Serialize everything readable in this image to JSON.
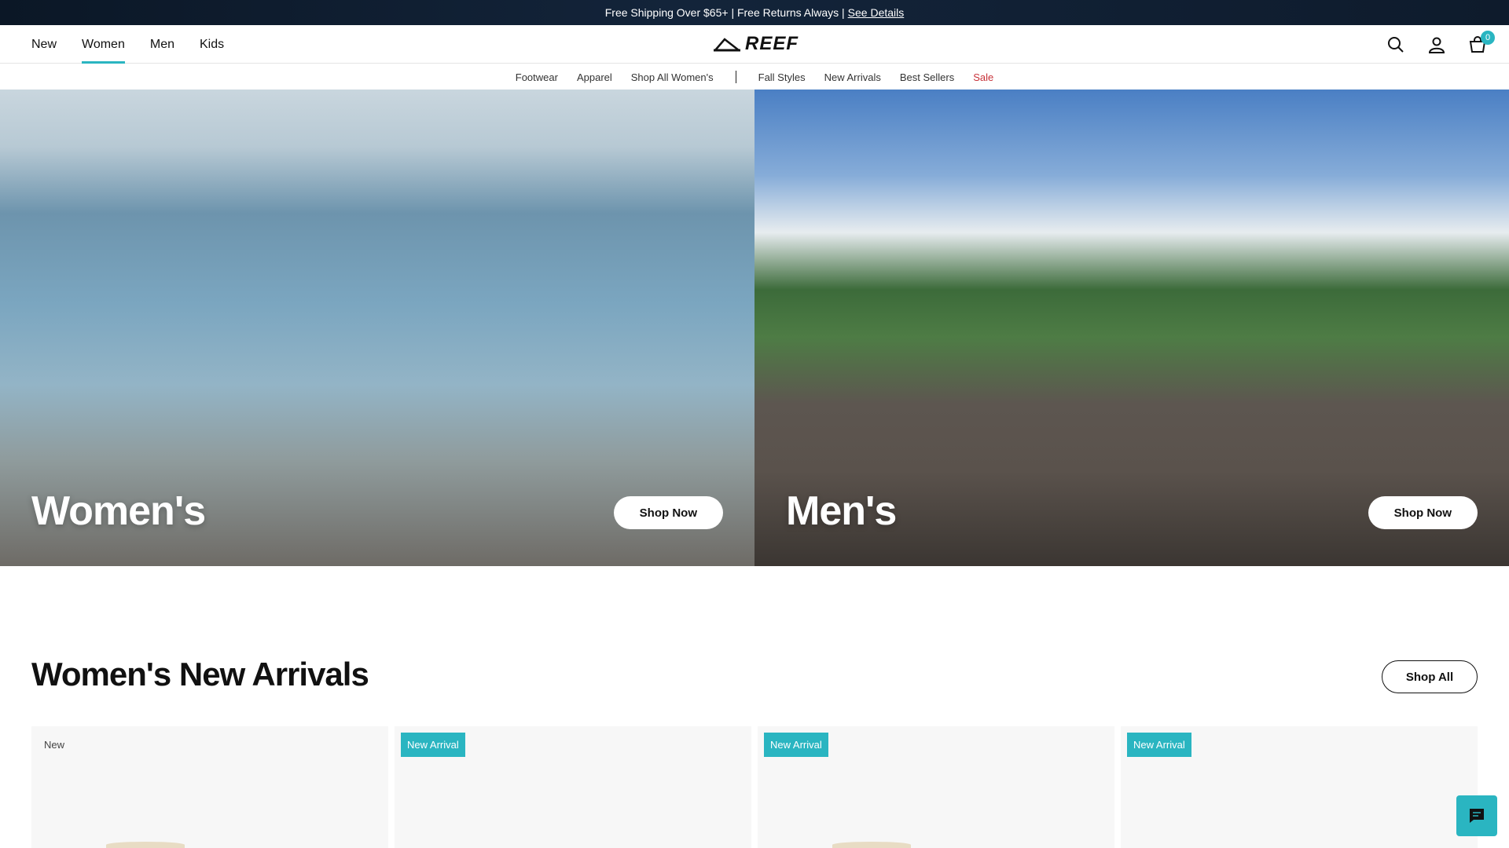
{
  "announcement": {
    "text": "Free Shipping Over $65+ | Free Returns Always |",
    "link": "See Details"
  },
  "main_nav": [
    "New",
    "Women",
    "Men",
    "Kids"
  ],
  "active_nav": "Women",
  "logo_text": "REEF",
  "icons": [
    "search-icon",
    "account-icon",
    "cart-icon",
    "chat-icon"
  ],
  "cart_count": "0",
  "subnav": {
    "left": [
      "Footwear",
      "Apparel",
      "Shop All Women's"
    ],
    "right": [
      "Fall Styles",
      "New Arrivals",
      "Best Sellers"
    ],
    "sale": "Sale"
  },
  "hero": {
    "womens": {
      "title": "Women's",
      "button": "Shop Now"
    },
    "mens": {
      "title": "Men's",
      "button": "Shop Now"
    }
  },
  "section": {
    "title": "Women's New Arrivals",
    "shop_all": "Shop All"
  },
  "products": [
    {
      "badge": "New"
    },
    {
      "badge": "New Arrival"
    },
    {
      "badge": "New Arrival"
    },
    {
      "badge": "New Arrival"
    }
  ],
  "colors": {
    "accent": "#2ab5c1",
    "sale": "#c8333a"
  }
}
